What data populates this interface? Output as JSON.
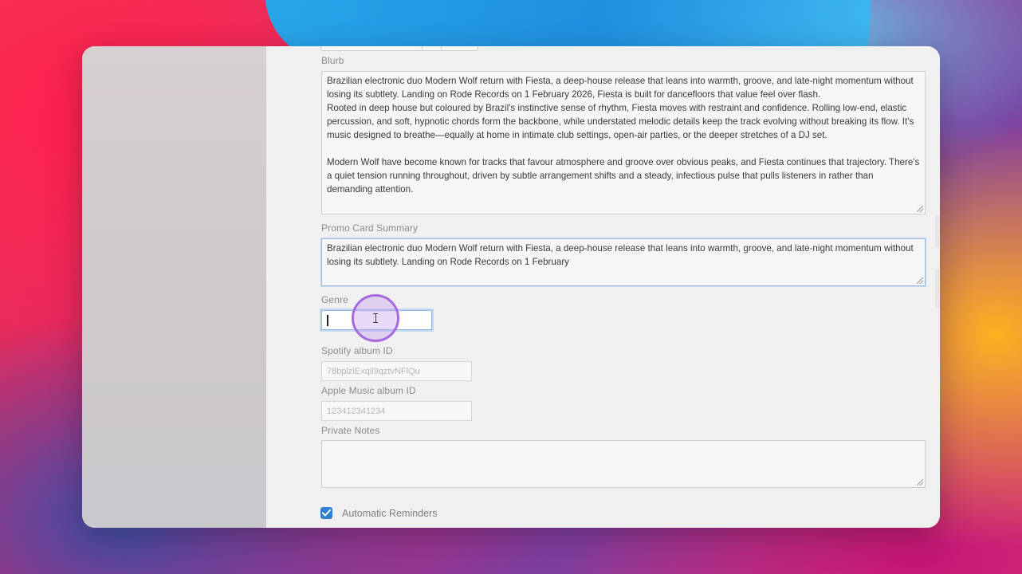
{
  "form": {
    "blurb": {
      "label": "Blurb",
      "paragraph_1": "Brazilian electronic duo Modern Wolf return with Fiesta, a deep-house release that leans into warmth, groove, and late-night momentum without losing its subtlety. Landing on Rode Records on 1 February 2026, Fiesta is built for dancefloors that value feel over flash.",
      "paragraph_2": "Rooted in deep house but coloured by Brazil's instinctive sense of rhythm, Fiesta moves with restraint and confidence. Rolling low-end, elastic percussion, and soft, hypnotic chords form the backbone, while understated melodic details keep the track evolving without breaking its flow. It's music designed to breathe—equally at home in intimate club settings, open-air parties, or the deeper stretches of a DJ set.",
      "paragraph_3": "Modern Wolf have become known for tracks that favour atmosphere and groove over obvious peaks, and Fiesta continues that trajectory. There's a quiet tension running throughout, driven by subtle arrangement shifts and a steady, infectious pulse that pulls listeners in rather than demanding attention."
    },
    "promo": {
      "label": "Promo Card Summary",
      "value": "Brazilian electronic duo Modern Wolf return with Fiesta, a deep-house release that leans into warmth, groove, and late-night momentum without losing its subtlety. Landing on Rode Records on 1 February"
    },
    "genre": {
      "label": "Genre",
      "value": ""
    },
    "spotify": {
      "label": "Spotify album ID",
      "placeholder": "78bplziExqil9qztvNFlQu"
    },
    "apple": {
      "label": "Apple Music album ID",
      "placeholder": "123412341234"
    },
    "notes": {
      "label": "Private Notes",
      "value": ""
    },
    "reminders": {
      "label": "Automatic Reminders",
      "checked": true
    }
  },
  "colors": {
    "checkbox": "#2f7fd3",
    "focus": "#8fb8e6",
    "cursor_ring": "#a868e0"
  },
  "icons": {
    "cursor": "text-cursor-icon",
    "check": "checkmark-icon"
  }
}
